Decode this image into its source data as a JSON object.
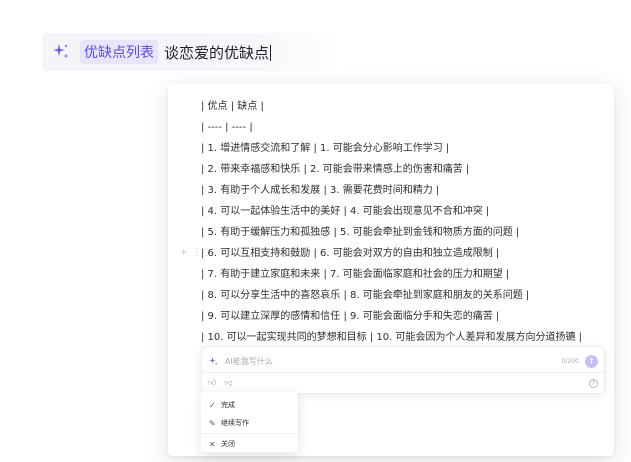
{
  "prompt": {
    "tag_label": "优缺点列表",
    "text": "谈恋爱的优缺点"
  },
  "document": {
    "lines": [
      "| 优点 | 缺点 |",
      "| ---- | ---- |",
      "| 1. 增进情感交流和了解 | 1. 可能会分心影响工作学习 |",
      "| 2. 带来幸福感和快乐 | 2. 可能会带来情感上的伤害和痛苦 |",
      "| 3. 有助于个人成长和发展 | 3. 需要花费时间和精力 |",
      "| 4. 可以一起体验生活中的美好 | 4. 可能会出现意见不合和冲突 |",
      "| 5. 有助于缓解压力和孤独感 | 5. 可能会牵扯到金钱和物质方面的问题 |",
      "| 6. 可以互相支持和鼓励 | 6. 可能会对双方的自由和独立造成限制 |",
      "| 7. 有助于建立家庭和未来 | 7. 可能会面临家庭和社会的压力和期望 |",
      "| 8. 可以分享生活中的喜怒哀乐 | 8. 可能会牵扯到家庭和朋友的关系问题 |",
      "| 9. 可以建立深厚的感情和信任 | 9. 可能会面临分手和失恋的痛苦 |",
      "| 10. 可以一起实现共同的梦想和目标 | 10. 可能会因为个人差异和发展方向分道扬镳 |"
    ]
  },
  "ai_input": {
    "placeholder": "AI能我写什么",
    "counter": "0/200"
  },
  "menu": {
    "items": [
      {
        "label": "完成",
        "icon": "check-icon"
      },
      {
        "label": "继续写作",
        "icon": "continue-writing-icon"
      },
      {
        "label": "关闭",
        "icon": "close-icon"
      }
    ]
  },
  "colors": {
    "accent": "#5b4fd6",
    "tag_bg": "#e7e4fb"
  }
}
